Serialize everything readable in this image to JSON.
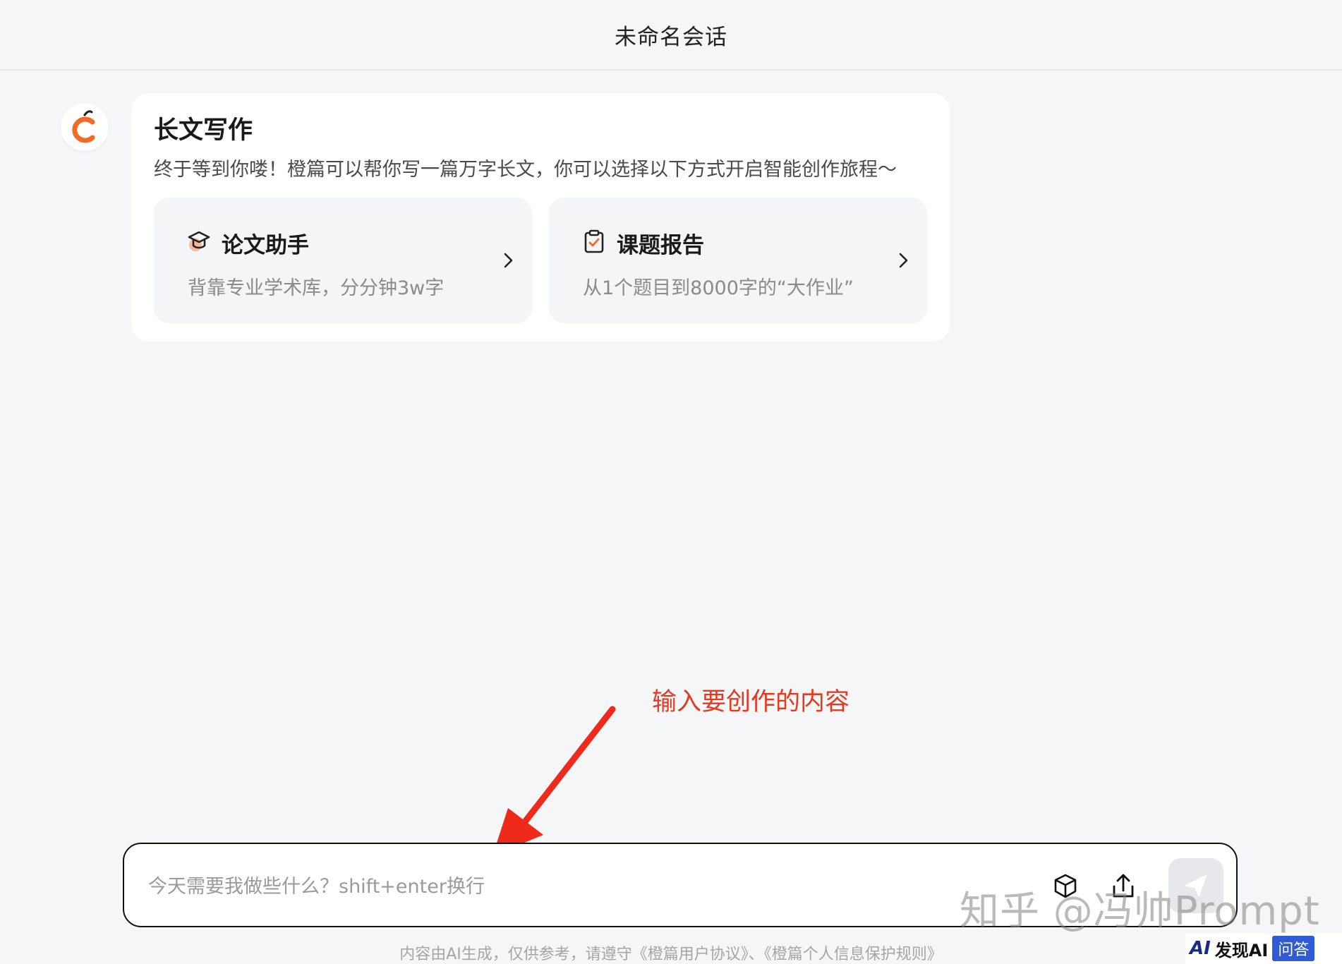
{
  "header": {
    "title": "未命名会话"
  },
  "assistant": {
    "avatar_icon": "orange-c-logo-icon"
  },
  "card": {
    "title": "长文写作",
    "description": "终于等到你喽！橙篇可以帮你写一篇万字长文，你可以选择以下方式开启智能创作旅程～",
    "options": [
      {
        "icon": "graduation-cap-icon",
        "title": "论文助手",
        "subtitle": "背靠专业学术库，分分钟3w字"
      },
      {
        "icon": "clipboard-check-icon",
        "title": "课题报告",
        "subtitle": "从1个题目到8000字的“大作业”"
      }
    ]
  },
  "annotation": {
    "text": "输入要创作的内容",
    "color": "#e8391f"
  },
  "input": {
    "placeholder": "今天需要我做些什么？shift+enter换行",
    "value": ""
  },
  "watermark": {
    "text": "知乎 @冯帅Prompt"
  },
  "footer": {
    "disclaimer": "内容由AI生成，仅供参考，请遵守《橙篇用户协议》、《橙篇个人信息保护规则》"
  },
  "badge": {
    "brand": "AI",
    "name": "发现AI",
    "tag": "问答"
  }
}
